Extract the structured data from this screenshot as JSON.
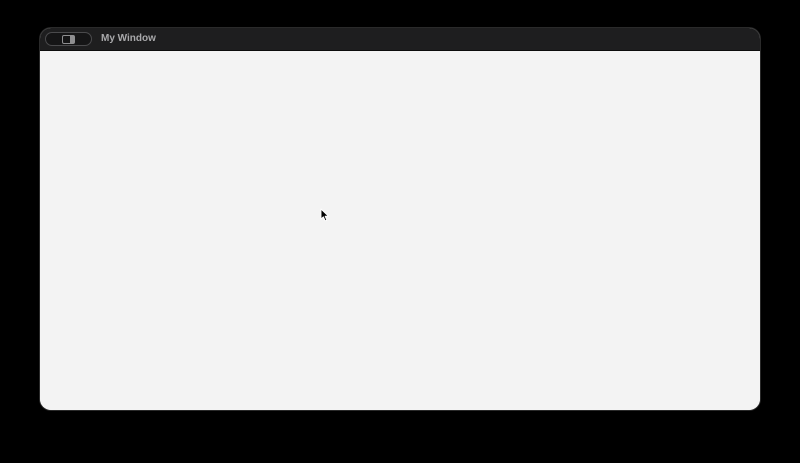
{
  "window": {
    "title": "My Window"
  },
  "titlebar": {
    "sidebar_toggle_icon": "sidebar-icon"
  },
  "colors": {
    "desktop_background": "#000000",
    "titlebar_background": "#1e1e1f",
    "title_text": "#a9a9ab",
    "content_background": "#f3f3f3"
  },
  "cursor": {
    "icon": "pointer-arrow-icon"
  }
}
